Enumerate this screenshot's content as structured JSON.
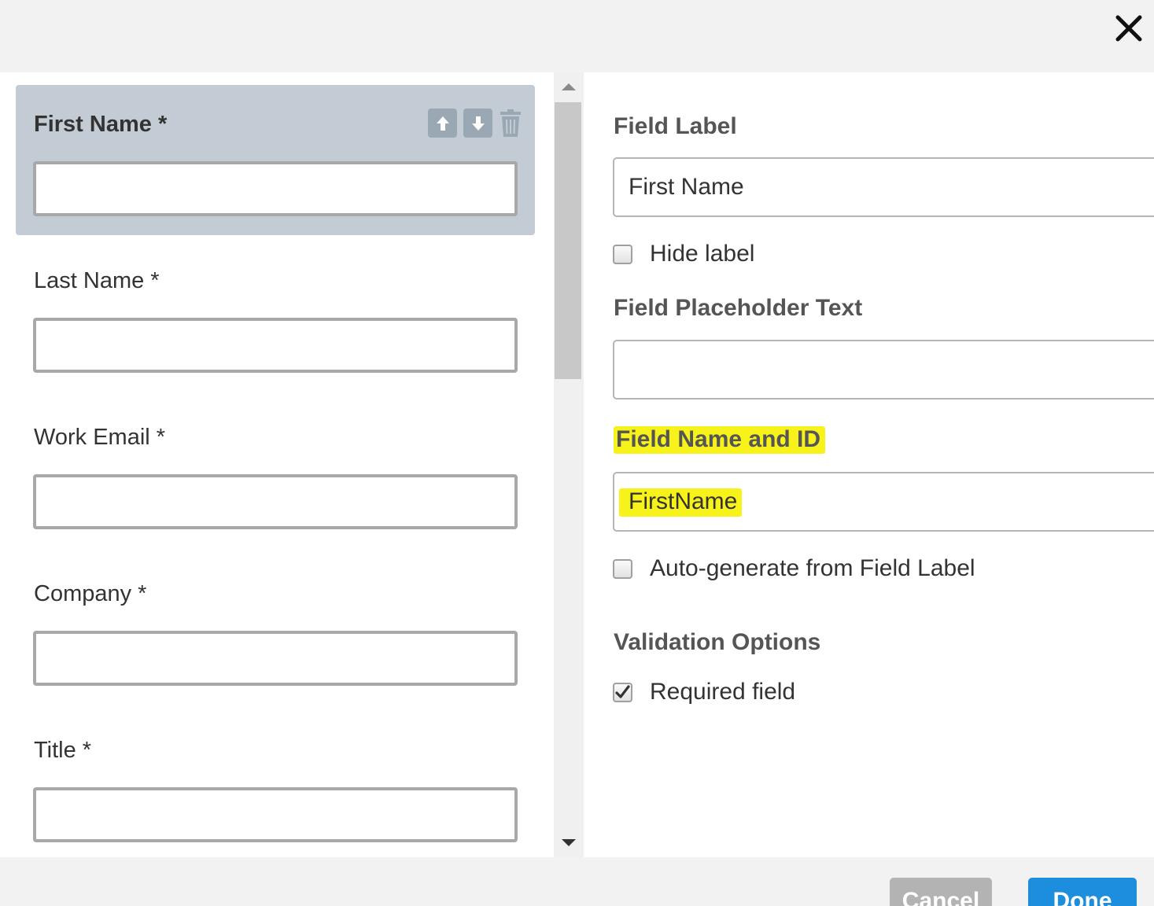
{
  "dialog": {
    "close_icon": "close-icon"
  },
  "form_fields": [
    {
      "label": "First Name *",
      "selected": true
    },
    {
      "label": "Last Name *",
      "selected": false
    },
    {
      "label": "Work Email *",
      "selected": false
    },
    {
      "label": "Company *",
      "selected": false
    },
    {
      "label": "Title *",
      "selected": false
    }
  ],
  "field_tools": {
    "move_up_icon": "arrow-up-icon",
    "move_down_icon": "arrow-down-icon",
    "delete_icon": "trash-icon"
  },
  "properties": {
    "field_label_heading": "Field Label",
    "field_label_value": "First Name",
    "hide_label": {
      "label": "Hide label",
      "checked": false
    },
    "placeholder_heading": "Field Placeholder Text",
    "placeholder_value": "",
    "name_id_heading": "Field Name and ID",
    "name_id_value": "FirstName",
    "auto_generate": {
      "label": "Auto-generate from Field Label",
      "checked": false
    },
    "validation_heading": "Validation Options",
    "required": {
      "label": "Required field",
      "checked": true
    }
  },
  "footer": {
    "cancel_label": "Cancel",
    "done_label": "Done"
  },
  "colors": {
    "selected_block": "#c3ccd4",
    "highlight": "#f7f21a",
    "done_button": "#1d8ede",
    "cancel_button": "#b3b3b3"
  }
}
